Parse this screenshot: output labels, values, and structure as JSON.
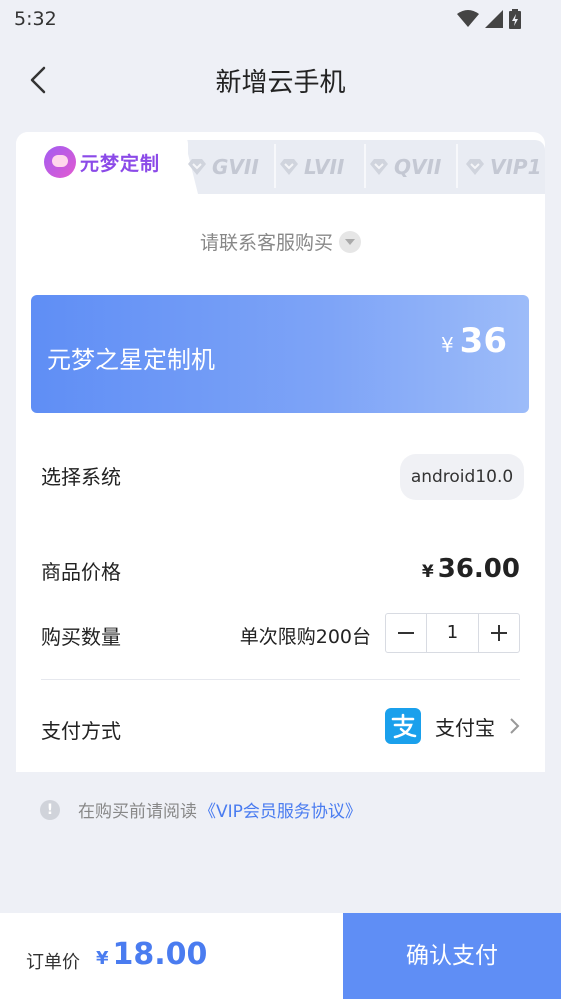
{
  "status": {
    "time": "5:32"
  },
  "header": {
    "title": "新增云手机"
  },
  "tabs": {
    "active": {
      "label": "元梦定制"
    },
    "items": [
      {
        "label": "GVII"
      },
      {
        "label": "LVII"
      },
      {
        "label": "QVII"
      },
      {
        "label": "VIP1"
      }
    ]
  },
  "contact": {
    "label": "请联系客服购买"
  },
  "product": {
    "name": "元梦之星定制机",
    "currency": "¥",
    "price": "36"
  },
  "system": {
    "label": "选择系统",
    "value": "android10.0"
  },
  "price": {
    "label": "商品价格",
    "currency": "¥",
    "value": "36.00"
  },
  "quantity": {
    "label": "购买数量",
    "limit_text": "单次限购200台",
    "value": "1"
  },
  "payment": {
    "label": "支付方式",
    "method": "支付宝"
  },
  "agreement": {
    "prefix": "在购买前请阅读",
    "link": "《VIP会员服务协议》"
  },
  "footer": {
    "order_label": "订单价",
    "currency": "¥",
    "order_price": "18.00",
    "confirm_label": "确认支付"
  },
  "colors": {
    "accent": "#5f8ef5",
    "link": "#4a7cf0",
    "tab_active": "#8b4ae8"
  }
}
